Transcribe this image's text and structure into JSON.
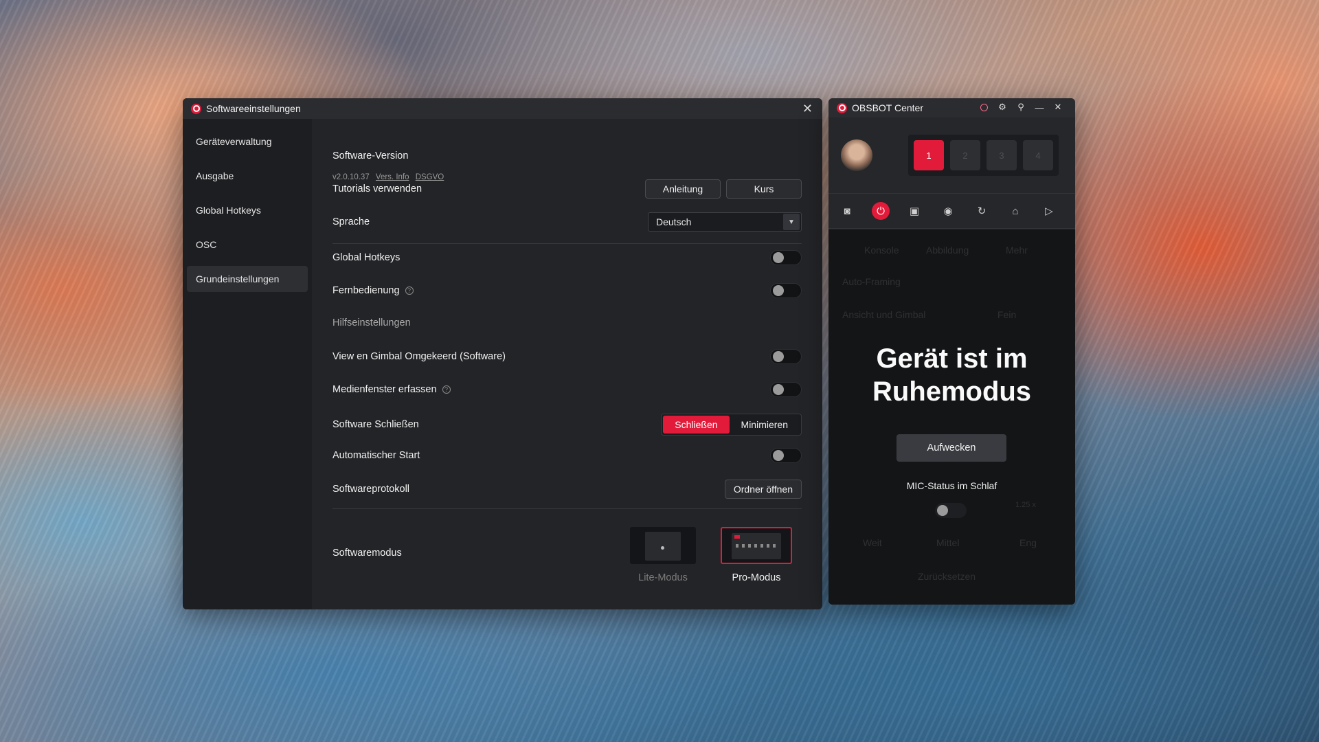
{
  "settings_window": {
    "title": "Softwareeinstellungen",
    "sidebar": {
      "items": [
        {
          "label": "Geräteverwaltung"
        },
        {
          "label": "Ausgabe"
        },
        {
          "label": "Global Hotkeys"
        },
        {
          "label": "OSC"
        },
        {
          "label": "Grundeinstellungen",
          "active": true
        }
      ]
    },
    "software_version": {
      "label": "Software-Version",
      "version": "v2.0.10.37",
      "vers_info_link": "Vers. Info",
      "dsgvo_link": "DSGVO"
    },
    "tutorials": {
      "label": "Tutorials verwenden",
      "guide_button": "Anleitung",
      "course_button": "Kurs"
    },
    "language": {
      "label": "Sprache",
      "value": "Deutsch"
    },
    "global_hotkeys": {
      "label": "Global Hotkeys",
      "enabled": false
    },
    "remote": {
      "label": "Fernbedienung",
      "enabled": false
    },
    "helper_section": {
      "label": "Hilfseinstellungen"
    },
    "view_gimbal_inverted": {
      "label": "View en Gimbal Omgekeerd (Software)",
      "enabled": false
    },
    "media_capture": {
      "label": "Medienfenster erfassen",
      "enabled": false
    },
    "software_close": {
      "label": "Software Schließen",
      "options": [
        "Schließen",
        "Minimieren"
      ],
      "selected": "Schließen"
    },
    "auto_start": {
      "label": "Automatischer Start",
      "enabled": false
    },
    "software_log": {
      "label": "Softwareprotokoll",
      "button": "Ordner öffnen"
    },
    "software_mode": {
      "label": "Softwaremodus",
      "lite_label": "Lite-Modus",
      "pro_label": "Pro-Modus",
      "selected": "Pro-Modus"
    }
  },
  "obsbot_window": {
    "title": "OBSBOT Center",
    "camera_slots": [
      "1",
      "2",
      "3",
      "4"
    ],
    "active_slot": "1",
    "ghost_tabs": [
      "Konsole",
      "Abbildung",
      "Mehr"
    ],
    "ghost_auto_framing": "Auto-Framing",
    "ghost_view_gimbal": "Ansicht und Gimbal",
    "ghost_fine": "Fein",
    "ghost_zoom": "1.25 x",
    "ghost_presets": [
      "Weit",
      "Mittel",
      "Eng"
    ],
    "ghost_reset": "Zurücksetzen",
    "sleep_title": "Gerät ist im Ruhemodus",
    "wake_button": "Aufwecken",
    "mic_status_label": "MIC-Status im Schlaf",
    "accent_color": "#e31b3a"
  }
}
